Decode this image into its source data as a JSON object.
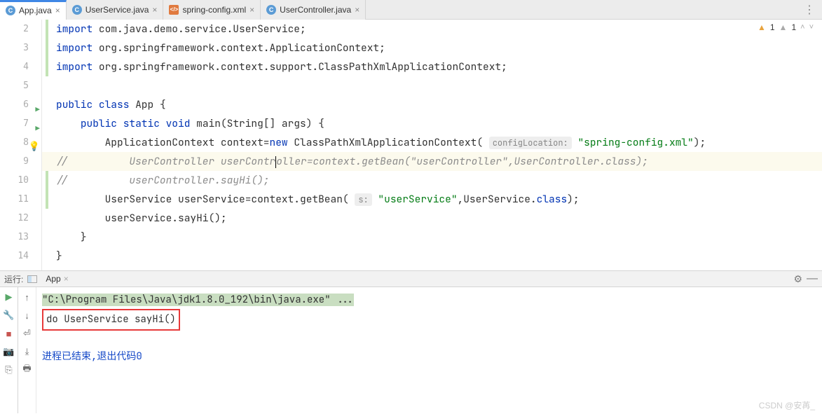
{
  "tabs": [
    {
      "label": "App.java",
      "iconText": "C",
      "iconClass": "java",
      "active": true
    },
    {
      "label": "UserService.java",
      "iconText": "C",
      "iconClass": "java",
      "active": false
    },
    {
      "label": "spring-config.xml",
      "iconText": "</>",
      "iconClass": "xml",
      "active": false
    },
    {
      "label": "UserController.java",
      "iconText": "C",
      "iconClass": "java",
      "active": false
    }
  ],
  "gutter": [
    "2",
    "3",
    "4",
    "5",
    "6",
    "7",
    "8",
    "9",
    "10",
    "11",
    "12",
    "13",
    "14"
  ],
  "code": {
    "l2": {
      "kw": "import ",
      "rest": "com.java.demo.service.UserService;"
    },
    "l3": {
      "kw": "import ",
      "rest": "org.springframework.context.ApplicationContext;"
    },
    "l4": {
      "kw": "import ",
      "rest": "org.springframework.context.support.ClassPathXmlApplicationContext;"
    },
    "l6": {
      "kw1": "public class ",
      "cls": "App ",
      "brace": "{"
    },
    "l7": {
      "pad": "    ",
      "kw1": "public static void ",
      "m": "main(String[] args) {"
    },
    "l8": {
      "pad": "        ",
      "a": "ApplicationContext context=",
      "kw": "new ",
      "b": "ClassPathXmlApplicationContext( ",
      "hint": "configLocation:",
      "sp": " ",
      "str": "\"spring-config.xml\"",
      "end": ");"
    },
    "l9": {
      "pad": "//          ",
      "c": "UserController userContr",
      "c2": "oller=context.getBean(\"userController\",UserController.class);"
    },
    "l10": {
      "pad": "//          ",
      "c": "userController.sayHi();"
    },
    "l11": {
      "pad": "        ",
      "a": "UserService userService=context.getBean( ",
      "hint": "s:",
      "sp": " ",
      "str": "\"userService\"",
      "mid": ",UserService.",
      "kw": "class",
      "end": ");"
    },
    "l12": {
      "pad": "        ",
      "a": "userService.sayHi();"
    },
    "l13": {
      "pad": "    ",
      "a": "}"
    },
    "l14": {
      "pad": "",
      "a": "}"
    }
  },
  "status": {
    "warn1": "1",
    "warn2": "1"
  },
  "runHeader": {
    "label": "运行:",
    "app": "App"
  },
  "console": {
    "cmd": "\"C:\\Program Files\\Java\\jdk1.8.0_192\\bin\\java.exe\" ...",
    "out": "do UserService sayHi()",
    "exit": "进程已结束,退出代码0"
  },
  "watermark": "CSDN @安苒_"
}
